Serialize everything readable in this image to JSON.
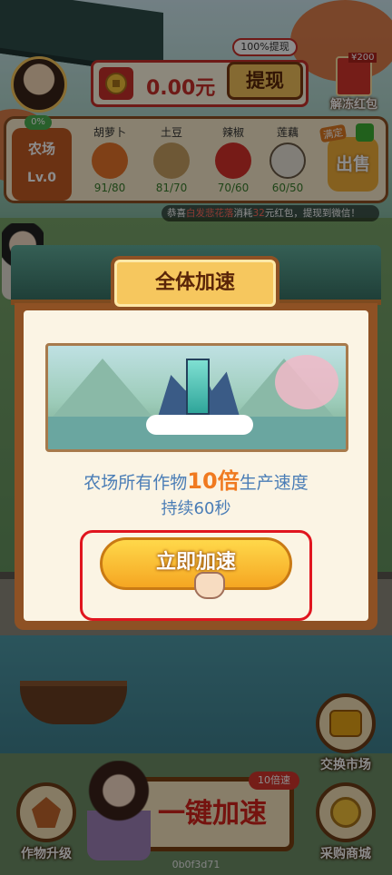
{
  "header": {
    "withdraw_tip": "100%提现",
    "balance": "0.00元",
    "withdraw_label": "提现",
    "redpack_tag": "¥200",
    "redpack_label": "解冻红包"
  },
  "farm": {
    "progress_pct": "0%",
    "name": "农场",
    "level": "Lv.0",
    "crops": [
      {
        "name": "胡萝卜",
        "qty": "91/80",
        "color": "#e8762a"
      },
      {
        "name": "土豆",
        "qty": "81/70",
        "color": "#c9a063"
      },
      {
        "name": "辣椒",
        "qty": "70/60",
        "color": "#d8322a"
      },
      {
        "name": "莲藕",
        "qty": "60/50",
        "color": "#ece6da"
      }
    ],
    "sell_tag": "满定",
    "sell_label": "出售"
  },
  "ticker": {
    "prefix": "恭喜",
    "user": "白发悲花落",
    "middle": "消耗",
    "amount": "32",
    "suffix": "元红包，提现到微信！"
  },
  "modal": {
    "title": "全体加速",
    "desc_prefix": "农场所有作物",
    "multiplier": "10倍",
    "desc_suffix": "生产速度",
    "duration": "持续60秒",
    "button_label": "立即加速"
  },
  "bottom": {
    "exchange_label": "交换市场",
    "shop_label": "采购商城",
    "upgrade_label": "作物升级",
    "boost_tag": "10倍速",
    "boost_label": "一键加速",
    "user_id": "0b0f3d71"
  }
}
